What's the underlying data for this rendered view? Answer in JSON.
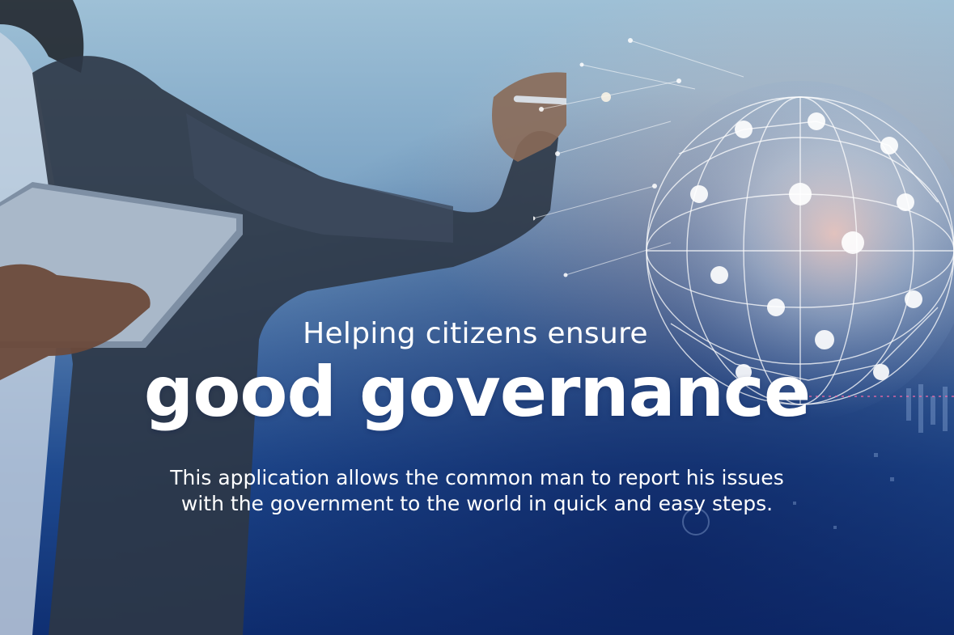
{
  "hero": {
    "tagline": "Helping citizens ensure",
    "title": "good governance",
    "description_line1": "This application allows the common man to report his issues",
    "description_line2": "with the government to the world in quick and easy steps."
  },
  "colors": {
    "text": "#ffffff",
    "background_top": "#9ec0d6",
    "background_bottom": "#0f2f72"
  }
}
